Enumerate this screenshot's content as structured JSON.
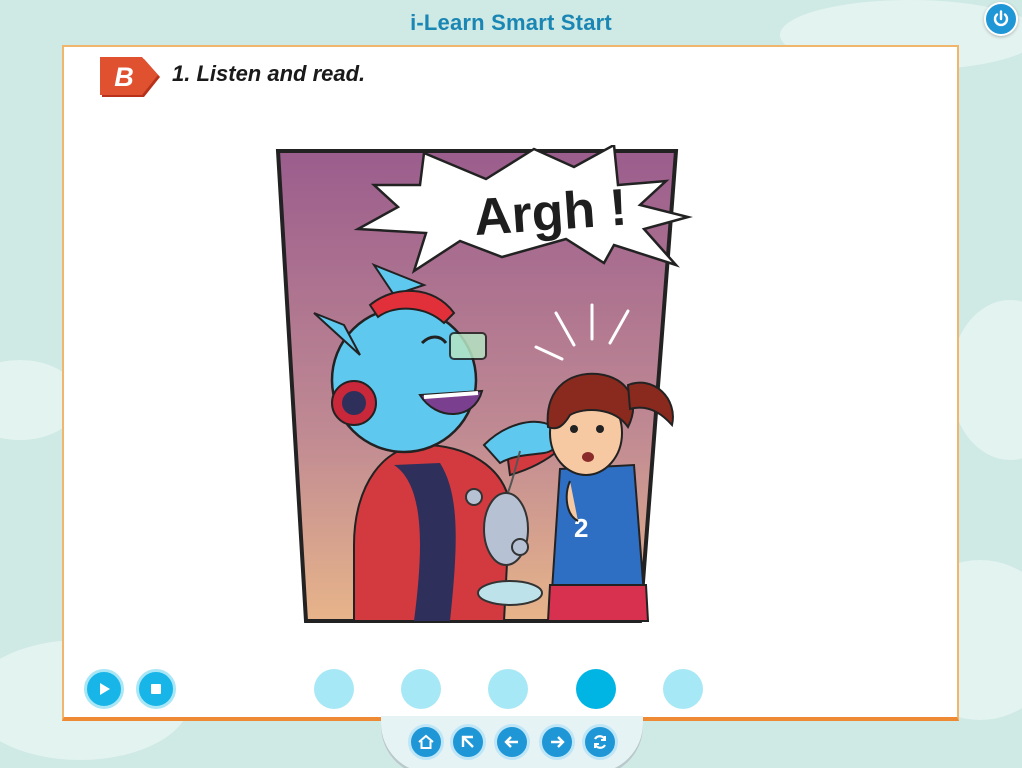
{
  "app": {
    "title": "i-Learn Smart Start"
  },
  "lesson": {
    "section_letter": "B",
    "instruction": "1. Listen and read.",
    "speech_text": "Argh !",
    "shirt_number": "2"
  },
  "controls": {
    "play_icon": "play-icon",
    "stop_icon": "stop-icon",
    "pages": [
      {
        "index": 1,
        "active": false
      },
      {
        "index": 2,
        "active": false
      },
      {
        "index": 3,
        "active": false
      },
      {
        "index": 4,
        "active": true
      },
      {
        "index": 5,
        "active": false
      }
    ]
  },
  "nav": {
    "icons": [
      "home-icon",
      "up-arrow-icon",
      "back-arrow-icon",
      "forward-arrow-icon",
      "refresh-icon"
    ]
  },
  "colors": {
    "accent": "#1f97d6",
    "panel_border": "#ee8a33",
    "badge": "#d9472b",
    "dot_active": "#00b4e4",
    "dot_inactive": "#a7e8f6"
  }
}
